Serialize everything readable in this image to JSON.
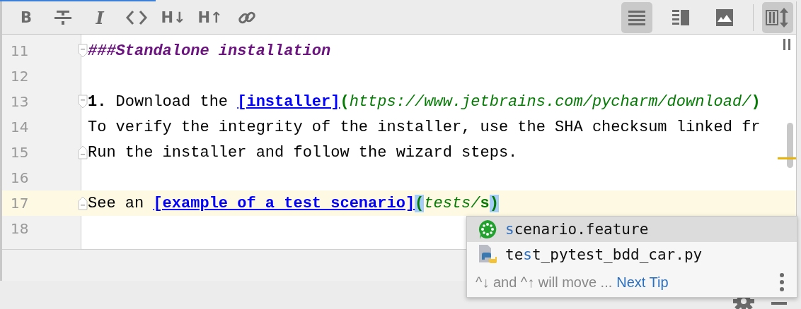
{
  "toolbar": {
    "format_buttons": [
      {
        "kind": "bold",
        "glyph": "B"
      },
      {
        "kind": "strikethrough"
      },
      {
        "kind": "italic",
        "glyph": "I"
      },
      {
        "kind": "code"
      },
      {
        "kind": "header-down",
        "glyph": "H↓"
      },
      {
        "kind": "header-up",
        "glyph": "H↑"
      },
      {
        "kind": "link"
      }
    ],
    "view_modes": [
      {
        "kind": "editor",
        "selected": true
      },
      {
        "kind": "split",
        "selected": false
      },
      {
        "kind": "preview",
        "selected": false
      }
    ],
    "sync_scroll": {
      "selected": true
    }
  },
  "editor": {
    "lines": [
      {
        "number": "11",
        "fold_start": true,
        "fold_end": false,
        "current": false,
        "segments": [
          {
            "kind": "heading",
            "text": "###Standalone installation"
          }
        ]
      },
      {
        "number": "12",
        "fold_start": false,
        "fold_end": false,
        "current": false
      },
      {
        "number": "13",
        "fold_start": true,
        "fold_end": false,
        "current": false,
        "segments": [
          {
            "kind": "bold",
            "text": "1."
          },
          {
            "kind": "plain",
            "text": " Download the "
          },
          {
            "kind": "link",
            "text": "[installer]"
          },
          {
            "kind": "paren",
            "text": "("
          },
          {
            "kind": "url",
            "text": "https://www.jetbrains.com/pycharm/download/"
          },
          {
            "kind": "paren",
            "text": ")"
          }
        ]
      },
      {
        "number": "14",
        "fold_start": false,
        "fold_end": false,
        "current": false,
        "segments": [
          {
            "kind": "plain",
            "text": "To verify the integrity of the installer, use the SHA checksum linked fr"
          }
        ]
      },
      {
        "number": "15",
        "fold_start": false,
        "fold_end": true,
        "current": false,
        "segments": [
          {
            "kind": "plain",
            "text": "Run the installer and follow the wizard steps."
          }
        ]
      },
      {
        "number": "16",
        "fold_start": false,
        "fold_end": false,
        "current": false
      },
      {
        "number": "17",
        "fold_start": false,
        "fold_end": true,
        "current": true,
        "segments": [
          {
            "kind": "plain",
            "text": "See an "
          },
          {
            "kind": "link",
            "text": "[example of a test scenario]"
          },
          {
            "kind": "paren-matched",
            "text": "("
          },
          {
            "kind": "url",
            "text": "tests/"
          },
          {
            "kind": "url-bold",
            "text": "s"
          },
          {
            "kind": "paren-matched",
            "text": ")"
          }
        ]
      },
      {
        "number": "18",
        "fold_start": false,
        "fold_end": false,
        "current": false
      }
    ]
  },
  "completion": {
    "items": [
      {
        "kind": "cucumber",
        "selected": true,
        "match": "s",
        "after": "cenario.feature"
      },
      {
        "kind": "python",
        "selected": false,
        "before": "te",
        "match": "s",
        "after": "t_pytest_bdd_car.py"
      }
    ],
    "hint": "^↓ and ^↑ will move ...",
    "next_tip": "Next Tip"
  }
}
